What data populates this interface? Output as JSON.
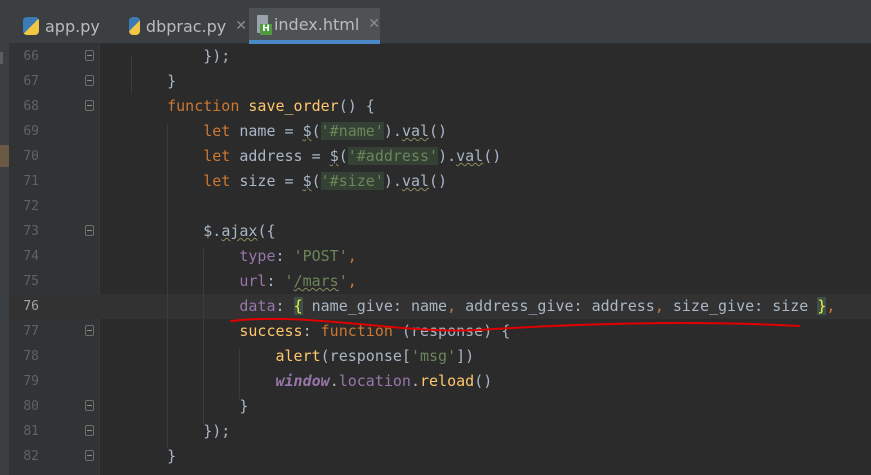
{
  "tabs": [
    {
      "label": "app.py",
      "icon": "python-file-icon",
      "active": false
    },
    {
      "label": "dbprac.py",
      "icon": "python-file-icon",
      "active": false
    },
    {
      "label": "index.html",
      "icon": "html-file-icon",
      "active": true
    }
  ],
  "tab_close_glyph": "✕",
  "current_line": "76",
  "colors": {
    "background": "#2b2b2b",
    "keyword": "#cc7832",
    "function": "#ffc66d",
    "string": "#6a8759",
    "property": "#9876aa",
    "default": "#a9b7c6",
    "annotation": "#e00000"
  },
  "lines": [
    {
      "num": "66",
      "indent": "        ",
      "tokens": [
        {
          "t": "});",
          "c": ""
        }
      ]
    },
    {
      "num": "67",
      "indent": "    ",
      "tokens": [
        {
          "t": "}",
          "c": ""
        }
      ]
    },
    {
      "num": "68",
      "indent": "    ",
      "tokens": [
        {
          "t": "function",
          "c": "kw"
        },
        {
          "t": " ",
          "c": ""
        },
        {
          "t": "save_order",
          "c": "fn"
        },
        {
          "t": "() {",
          "c": ""
        }
      ]
    },
    {
      "num": "69",
      "indent": "        ",
      "tokens": [
        {
          "t": "let",
          "c": "kw"
        },
        {
          "t": " name = ",
          "c": ""
        },
        {
          "t": "$",
          "c": "wavy"
        },
        {
          "t": "(",
          "c": ""
        },
        {
          "t": "'#name'",
          "c": "str hlstr"
        },
        {
          "t": ").",
          "c": ""
        },
        {
          "t": "val",
          "c": "wavy"
        },
        {
          "t": "()",
          "c": ""
        }
      ]
    },
    {
      "num": "70",
      "indent": "        ",
      "tokens": [
        {
          "t": "let",
          "c": "kw"
        },
        {
          "t": " address = ",
          "c": ""
        },
        {
          "t": "$",
          "c": "wavy"
        },
        {
          "t": "(",
          "c": ""
        },
        {
          "t": "'#address'",
          "c": "str hlstr"
        },
        {
          "t": ").",
          "c": ""
        },
        {
          "t": "val",
          "c": "wavy"
        },
        {
          "t": "()",
          "c": ""
        }
      ]
    },
    {
      "num": "71",
      "indent": "        ",
      "tokens": [
        {
          "t": "let",
          "c": "kw"
        },
        {
          "t": " size = ",
          "c": ""
        },
        {
          "t": "$",
          "c": "wavy"
        },
        {
          "t": "(",
          "c": ""
        },
        {
          "t": "'#size'",
          "c": "str hlstr"
        },
        {
          "t": ").",
          "c": ""
        },
        {
          "t": "val",
          "c": "wavy"
        },
        {
          "t": "()",
          "c": ""
        }
      ]
    },
    {
      "num": "72",
      "indent": "",
      "tokens": []
    },
    {
      "num": "73",
      "indent": "        ",
      "tokens": [
        {
          "t": "$",
          "c": ""
        },
        {
          "t": ".",
          "c": ""
        },
        {
          "t": "ajax",
          "c": "wavy"
        },
        {
          "t": "({",
          "c": ""
        }
      ]
    },
    {
      "num": "74",
      "indent": "            ",
      "tokens": [
        {
          "t": "type",
          "c": "prop"
        },
        {
          "t": ": ",
          "c": ""
        },
        {
          "t": "'POST'",
          "c": "str"
        },
        {
          "t": ",",
          "c": "kw"
        }
      ]
    },
    {
      "num": "75",
      "indent": "            ",
      "tokens": [
        {
          "t": "url",
          "c": "prop"
        },
        {
          "t": ": ",
          "c": ""
        },
        {
          "t": "'",
          "c": "str"
        },
        {
          "t": "/mars",
          "c": "str wavy"
        },
        {
          "t": "'",
          "c": "str"
        },
        {
          "t": ",",
          "c": "kw"
        }
      ]
    },
    {
      "num": "76",
      "indent": "            ",
      "tokens": [
        {
          "t": "data",
          "c": "prop"
        },
        {
          "t": ": ",
          "c": ""
        },
        {
          "t": "{",
          "c": "brace-hl"
        },
        {
          "t": " name_give: name",
          "c": ""
        },
        {
          "t": ",",
          "c": "kw"
        },
        {
          "t": " address_give: address",
          "c": ""
        },
        {
          "t": ",",
          "c": "kw"
        },
        {
          "t": " size_give: size ",
          "c": ""
        },
        {
          "t": "}",
          "c": "brace-hl"
        },
        {
          "t": ",",
          "c": "kw"
        }
      ]
    },
    {
      "num": "77",
      "indent": "            ",
      "tokens": [
        {
          "t": "success",
          "c": "fn"
        },
        {
          "t": ": ",
          "c": ""
        },
        {
          "t": "function",
          "c": "kw"
        },
        {
          "t": " (response) {",
          "c": ""
        }
      ]
    },
    {
      "num": "78",
      "indent": "                ",
      "tokens": [
        {
          "t": "alert",
          "c": "fn"
        },
        {
          "t": "(response[",
          "c": ""
        },
        {
          "t": "'msg'",
          "c": "str"
        },
        {
          "t": "])",
          "c": ""
        }
      ]
    },
    {
      "num": "79",
      "indent": "                ",
      "tokens": [
        {
          "t": "window",
          "c": "glob"
        },
        {
          "t": ".",
          "c": ""
        },
        {
          "t": "location",
          "c": "prop"
        },
        {
          "t": ".",
          "c": ""
        },
        {
          "t": "reload",
          "c": "fn"
        },
        {
          "t": "()",
          "c": ""
        }
      ]
    },
    {
      "num": "80",
      "indent": "            ",
      "tokens": [
        {
          "t": "}",
          "c": ""
        }
      ]
    },
    {
      "num": "81",
      "indent": "        ",
      "tokens": [
        {
          "t": "});",
          "c": ""
        }
      ]
    },
    {
      "num": "82",
      "indent": "    ",
      "tokens": [
        {
          "t": "}",
          "c": ""
        }
      ]
    }
  ]
}
